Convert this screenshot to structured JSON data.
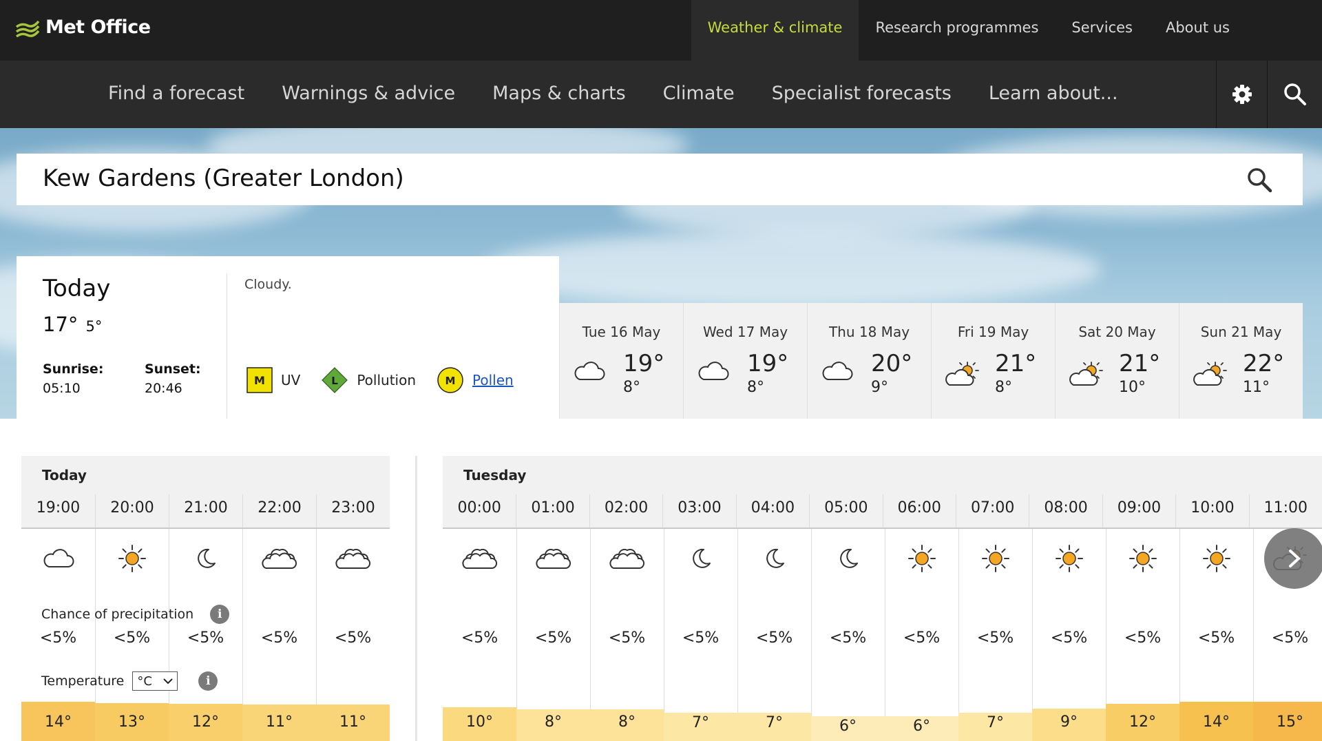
{
  "brand": {
    "name": "Met Office"
  },
  "topnav": [
    {
      "label": "Weather & climate",
      "active": true
    },
    {
      "label": "Research programmes",
      "active": false
    },
    {
      "label": "Services",
      "active": false
    },
    {
      "label": "About us",
      "active": false
    }
  ],
  "mainnav": [
    "Find a forecast",
    "Warnings & advice",
    "Maps & charts",
    "Climate",
    "Specialist forecasts",
    "Learn about..."
  ],
  "location": {
    "value": "Kew Gardens (Greater London)"
  },
  "today": {
    "title": "Today",
    "max": "17°",
    "min": "5°",
    "sunrise_label": "Sunrise:",
    "sunrise": "05:10",
    "sunset_label": "Sunset:",
    "sunset": "20:46",
    "summary": "Cloudy.",
    "uv_level": "M",
    "uv_label": "UV",
    "pollution_level": "L",
    "pollution_label": "Pollution",
    "pollen_level": "M",
    "pollen_label": "Pollen"
  },
  "days": [
    {
      "date": "Tue 16 May",
      "max": "19°",
      "min": "8°",
      "icon": "cloudy-icon"
    },
    {
      "date": "Wed 17 May",
      "max": "19°",
      "min": "8°",
      "icon": "cloudy-icon"
    },
    {
      "date": "Thu 18 May",
      "max": "20°",
      "min": "9°",
      "icon": "cloudy-icon"
    },
    {
      "date": "Fri 19 May",
      "max": "21°",
      "min": "8°",
      "icon": "sunny-intervals-icon"
    },
    {
      "date": "Sat 20 May",
      "max": "21°",
      "min": "10°",
      "icon": "sunny-intervals-icon"
    },
    {
      "date": "Sun 21 May",
      "max": "22°",
      "min": "11°",
      "icon": "sunny-intervals-icon"
    }
  ],
  "hourly": {
    "precip_label": "Chance of precipitation",
    "temp_label": "Temperature",
    "temp_unit": "°C",
    "today": {
      "label": "Today",
      "hours": [
        {
          "time": "19:00",
          "icon": "cloudy-icon",
          "precip": "<5%",
          "temp": "14°",
          "color": "#f7c55c",
          "level": 1.0
        },
        {
          "time": "20:00",
          "icon": "sun-icon",
          "precip": "<5%",
          "temp": "13°",
          "color": "#f8ca62",
          "level": 0.97
        },
        {
          "time": "21:00",
          "icon": "moon-icon",
          "precip": "<5%",
          "temp": "12°",
          "color": "#f9cf6c",
          "level": 0.95
        },
        {
          "time": "22:00",
          "icon": "partly-cloudy-night-icon",
          "precip": "<5%",
          "temp": "11°",
          "color": "#fad577",
          "level": 0.93
        },
        {
          "time": "23:00",
          "icon": "partly-cloudy-night-icon",
          "precip": "<5%",
          "temp": "11°",
          "color": "#fad577",
          "level": 0.93
        }
      ]
    },
    "tuesday": {
      "label": "Tuesday",
      "hours": [
        {
          "time": "00:00",
          "icon": "partly-cloudy-night-icon",
          "precip": "<5%",
          "temp": "10°",
          "color": "#fbd97f",
          "level": 0.86
        },
        {
          "time": "01:00",
          "icon": "partly-cloudy-night-icon",
          "precip": "<5%",
          "temp": "8°",
          "color": "#fde399",
          "level": 0.8
        },
        {
          "time": "02:00",
          "icon": "partly-cloudy-night-icon",
          "precip": "<5%",
          "temp": "8°",
          "color": "#fde399",
          "level": 0.8
        },
        {
          "time": "03:00",
          "icon": "moon-icon",
          "precip": "<5%",
          "temp": "7°",
          "color": "#fde7a5",
          "level": 0.72
        },
        {
          "time": "04:00",
          "icon": "moon-icon",
          "precip": "<5%",
          "temp": "7°",
          "color": "#fde7a5",
          "level": 0.72
        },
        {
          "time": "05:00",
          "icon": "moon-icon",
          "precip": "<5%",
          "temp": "6°",
          "color": "#feecb8",
          "level": 0.64
        },
        {
          "time": "06:00",
          "icon": "sun-icon",
          "precip": "<5%",
          "temp": "6°",
          "color": "#feecb8",
          "level": 0.64
        },
        {
          "time": "07:00",
          "icon": "sun-icon",
          "precip": "<5%",
          "temp": "7°",
          "color": "#fde7a5",
          "level": 0.72
        },
        {
          "time": "08:00",
          "icon": "sun-icon",
          "precip": "<5%",
          "temp": "9°",
          "color": "#fcdd8a",
          "level": 0.82
        },
        {
          "time": "09:00",
          "icon": "sun-icon",
          "precip": "<5%",
          "temp": "12°",
          "color": "#f9cd66",
          "level": 0.95
        },
        {
          "time": "10:00",
          "icon": "sun-icon",
          "precip": "<5%",
          "temp": "14°",
          "color": "#f7c14f",
          "level": 1.0
        },
        {
          "time": "11:00",
          "icon": "sunny-intervals-icon",
          "precip": "<5%",
          "temp": "15°",
          "color": "#f6b84a",
          "level": 1.0
        }
      ]
    }
  },
  "colors": {
    "accent": "#c7dc3b",
    "topbar": "#1f1f1f",
    "navbar": "#2b2b2b",
    "link": "#1a55c5",
    "uv": "#f2e200",
    "pollution": "#5fa83a",
    "pollen": "#f2e200",
    "sun": "#f5a623"
  }
}
